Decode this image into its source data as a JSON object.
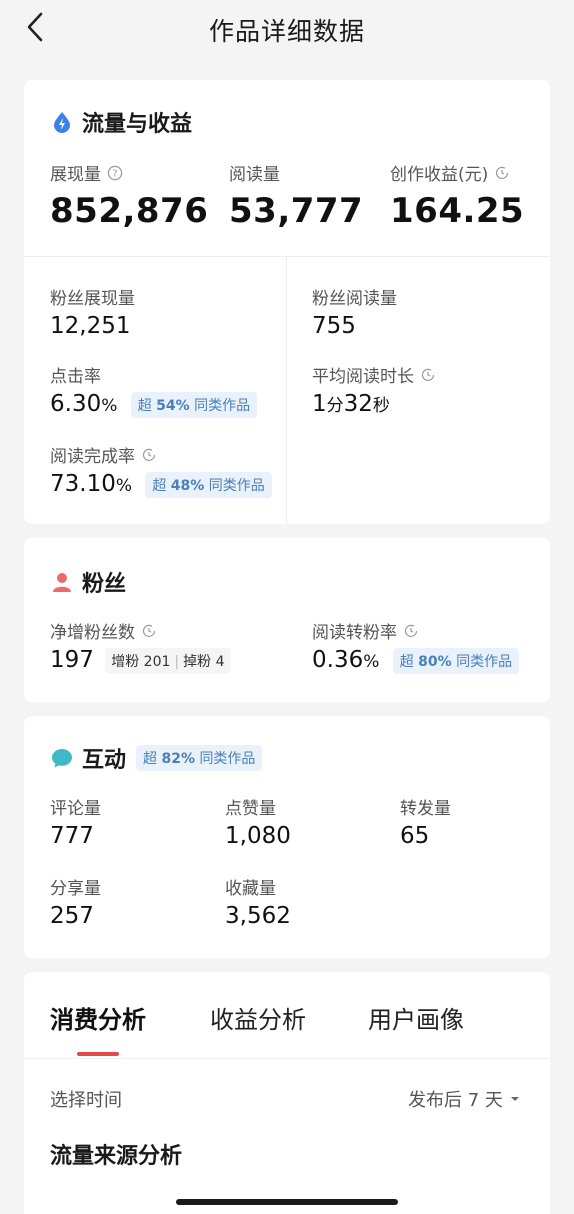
{
  "header": {
    "title": "作品详细数据"
  },
  "traffic": {
    "title": "流量与收益",
    "impressions": {
      "label": "展现量",
      "value": "852,876"
    },
    "reads": {
      "label": "阅读量",
      "value": "53,777"
    },
    "earnings": {
      "label": "创作收益(元)",
      "value": "164.25"
    },
    "fan_impressions": {
      "label": "粉丝展现量",
      "value": "12,251"
    },
    "fan_reads": {
      "label": "粉丝阅读量",
      "value": "755"
    },
    "ctr": {
      "label": "点击率",
      "value": "6.30",
      "unit": "%",
      "badge_prefix": "超",
      "badge_pct": "54%",
      "badge_suffix": "同类作品"
    },
    "avg_read_time": {
      "label": "平均阅读时长",
      "min": "1",
      "min_unit": "分",
      "sec": "32",
      "sec_unit": "秒"
    },
    "completion": {
      "label": "阅读完成率",
      "value": "73.10",
      "unit": "%",
      "badge_prefix": "超",
      "badge_pct": "48%",
      "badge_suffix": "同类作品"
    }
  },
  "fans": {
    "title": "粉丝",
    "net_gain": {
      "label": "净增粉丝数",
      "value": "197",
      "gain_label": "增粉",
      "gain": "201",
      "loss_label": "掉粉",
      "loss": "4"
    },
    "conversion": {
      "label": "阅读转粉率",
      "value": "0.36",
      "unit": "%",
      "badge_prefix": "超",
      "badge_pct": "80%",
      "badge_suffix": "同类作品"
    }
  },
  "interaction": {
    "title": "互动",
    "badge_prefix": "超",
    "badge_pct": "82%",
    "badge_suffix": "同类作品",
    "comments": {
      "label": "评论量",
      "value": "777"
    },
    "likes": {
      "label": "点赞量",
      "value": "1,080"
    },
    "reposts": {
      "label": "转发量",
      "value": "65"
    },
    "shares": {
      "label": "分享量",
      "value": "257"
    },
    "favorites": {
      "label": "收藏量",
      "value": "3,562"
    }
  },
  "analysis": {
    "tabs": [
      "消费分析",
      "收益分析",
      "用户画像"
    ],
    "time_label": "选择时间",
    "time_value": "发布后 7 天",
    "source_title": "流量来源分析"
  },
  "colors": {
    "accent_blue": "#3b82e6",
    "accent_red": "#e04a4a",
    "fans_icon": "#e86c6c",
    "chat_icon": "#3fb8c8",
    "badge_text": "#4a7fb8"
  }
}
